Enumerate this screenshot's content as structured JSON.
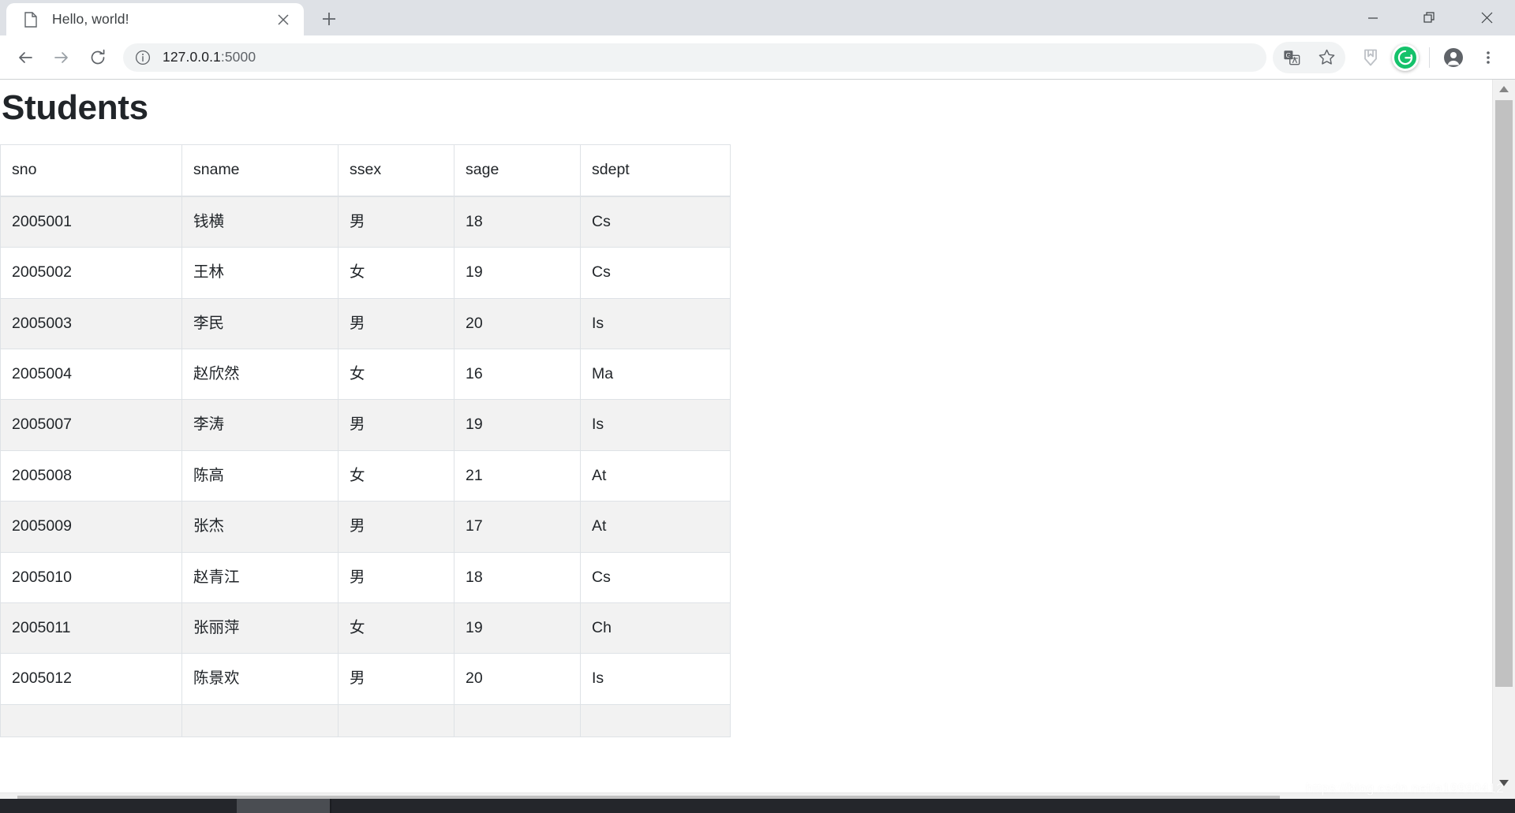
{
  "browser": {
    "tab": {
      "title": "Hello, world!",
      "favicon_icon": "document-icon",
      "close_icon": "close-icon"
    },
    "new_tab_icon": "plus-icon",
    "window_controls": {
      "minimize_icon": "minimize-icon",
      "restore_icon": "restore-icon",
      "close_icon": "window-close-icon"
    },
    "toolbar": {
      "back_icon": "back-arrow-icon",
      "forward_icon": "forward-arrow-icon",
      "reload_icon": "reload-icon",
      "site_info_icon": "info-circle-icon",
      "url_host": "127.0.0.1",
      "url_port": ":5000",
      "url_full": "127.0.0.1:5000",
      "translate_icon": "translate-icon",
      "bookmark_icon": "star-icon",
      "extension_icon": "shield-extension-icon",
      "grammarly_icon": "grammarly-icon",
      "grammarly_letter": "G",
      "profile_icon": "profile-avatar-icon",
      "menu_icon": "three-dot-menu-icon"
    }
  },
  "page": {
    "title": "Students",
    "table": {
      "columns": [
        "sno",
        "sname",
        "ssex",
        "sage",
        "sdept"
      ],
      "rows": [
        [
          "2005001",
          "钱横",
          "男",
          "18",
          "Cs"
        ],
        [
          "2005002",
          "王林",
          "女",
          "19",
          "Cs"
        ],
        [
          "2005003",
          "李民",
          "男",
          "20",
          "Is"
        ],
        [
          "2005004",
          "赵欣然",
          "女",
          "16",
          "Ma"
        ],
        [
          "2005007",
          "李涛",
          "男",
          "19",
          "Is"
        ],
        [
          "2005008",
          "陈高",
          "女",
          "21",
          "At"
        ],
        [
          "2005009",
          "张杰",
          "男",
          "17",
          "At"
        ],
        [
          "2005010",
          "赵青江",
          "男",
          "18",
          "Cs"
        ],
        [
          "2005011",
          "张丽萍",
          "女",
          "19",
          "Ch"
        ],
        [
          "2005012",
          "陈景欢",
          "男",
          "20",
          "Is"
        ],
        [
          "",
          "",
          "",
          "",
          ""
        ]
      ]
    }
  },
  "scrollbars": {
    "vertical_up_icon": "scroll-up-arrow-icon",
    "vertical_down_icon": "scroll-down-arrow-icon",
    "horizontal_left_icon": "scroll-left-arrow-icon"
  },
  "watermark": {
    "text": "https://blog.csdn.net/a19990412"
  },
  "colors": {
    "tabstrip_bg": "#dee1e6",
    "table_border": "#dee2e6",
    "stripe": "#f2f2f2",
    "grammarly_green": "#15c26b",
    "scroll_thumb": "#c1c1c1",
    "taskbar": "#24262b"
  }
}
